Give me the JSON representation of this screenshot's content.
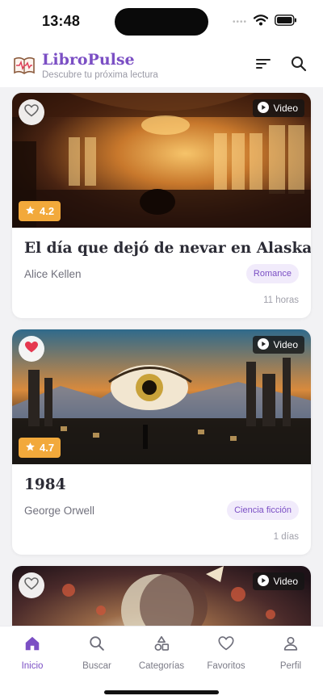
{
  "status_bar": {
    "time": "13:48",
    "dots": "••••"
  },
  "header": {
    "title": "LibroPulse",
    "subtitle": "Descubre tu próxima lectura"
  },
  "books": [
    {
      "title": "El día que dejó de nevar en Alaska",
      "author": "Alice Kellen",
      "genre": "Romance",
      "rating": "4.2",
      "time_ago": "11 horas",
      "video_label": "Video",
      "favorited": false
    },
    {
      "title": "1984",
      "author": "George Orwell",
      "genre": "Ciencia ficción",
      "rating": "4.7",
      "time_ago": "1 días",
      "video_label": "Video",
      "favorited": true
    },
    {
      "video_label": "Video",
      "favorited": false
    }
  ],
  "tabs": [
    {
      "label": "Inicio",
      "icon": "home-icon",
      "active": true
    },
    {
      "label": "Buscar",
      "icon": "search-icon",
      "active": false
    },
    {
      "label": "Categorías",
      "icon": "shapes-icon",
      "active": false
    },
    {
      "label": "Favoritos",
      "icon": "heart-icon",
      "active": false
    },
    {
      "label": "Perfil",
      "icon": "user-icon",
      "active": false
    }
  ],
  "colors": {
    "accent": "#7b4fc4",
    "rating": "#f2a93b",
    "favorite": "#e53950",
    "tag_bg": "#f1ebfb"
  }
}
